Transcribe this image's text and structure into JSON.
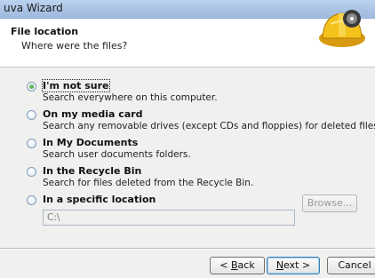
{
  "window": {
    "title": "uva Wizard"
  },
  "header": {
    "title": "File location",
    "subtitle": "Where were the files?"
  },
  "options": [
    {
      "label": "I'm not sure",
      "description": "Search everywhere on this computer.",
      "selected": true
    },
    {
      "label": "On my media card",
      "description": "Search any removable drives (except CDs and floppies) for deleted files.",
      "selected": false
    },
    {
      "label": "In My Documents",
      "description": "Search user documents folders.",
      "selected": false
    },
    {
      "label": "In the Recycle Bin",
      "description": "Search for files deleted from the Recycle Bin.",
      "selected": false
    },
    {
      "label": "In a specific location",
      "description": "",
      "selected": false
    }
  ],
  "location": {
    "path_value": "C:\\",
    "browse_label": "Browse..."
  },
  "footer": {
    "back_prefix": "< ",
    "back_key": "B",
    "back_rest": "ack",
    "next_key": "N",
    "next_rest": "ext >",
    "cancel_label": "Cancel"
  },
  "icons": {
    "wizard": "recuva-hard-hat-icon"
  },
  "colors": {
    "titlebar": "#a9c2e3",
    "radio_selected": "#2a8a26"
  }
}
